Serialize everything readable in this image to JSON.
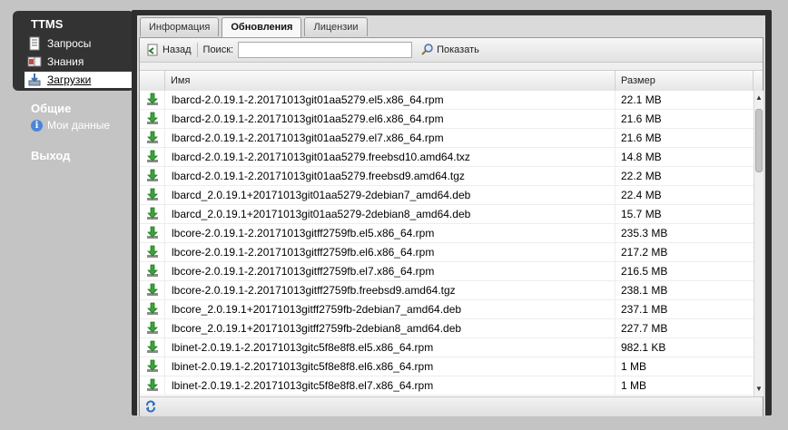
{
  "nav": {
    "title": "TTMS",
    "items": [
      {
        "label": "Запросы",
        "icon": "document-icon"
      },
      {
        "label": "Знания",
        "icon": "book-icon"
      },
      {
        "label": "Загрузки",
        "icon": "download-icon"
      }
    ],
    "section_general": "Общие",
    "my_data": "Мои данные",
    "logout": "Выход"
  },
  "tabs": [
    "Информация",
    "Обновления",
    "Лицензии"
  ],
  "toolbar": {
    "back_label": "Назад",
    "search_label": "Поиск:",
    "search_value": "",
    "show_label": "Показать"
  },
  "grid": {
    "columns": [
      "Имя",
      "Размер"
    ],
    "rows": [
      {
        "name": "lbarcd-2.0.19.1-2.20171013git01aa5279.el5.x86_64.rpm",
        "size": "22.1 MB"
      },
      {
        "name": "lbarcd-2.0.19.1-2.20171013git01aa5279.el6.x86_64.rpm",
        "size": "21.6 MB"
      },
      {
        "name": "lbarcd-2.0.19.1-2.20171013git01aa5279.el7.x86_64.rpm",
        "size": "21.6 MB"
      },
      {
        "name": "lbarcd-2.0.19.1-2.20171013git01aa5279.freebsd10.amd64.txz",
        "size": "14.8 MB"
      },
      {
        "name": "lbarcd-2.0.19.1-2.20171013git01aa5279.freebsd9.amd64.tgz",
        "size": "22.2 MB"
      },
      {
        "name": "lbarcd_2.0.19.1+20171013git01aa5279-2debian7_amd64.deb",
        "size": "22.4 MB"
      },
      {
        "name": "lbarcd_2.0.19.1+20171013git01aa5279-2debian8_amd64.deb",
        "size": "15.7 MB"
      },
      {
        "name": "lbcore-2.0.19.1-2.20171013gitff2759fb.el5.x86_64.rpm",
        "size": "235.3 MB"
      },
      {
        "name": "lbcore-2.0.19.1-2.20171013gitff2759fb.el6.x86_64.rpm",
        "size": "217.2 MB"
      },
      {
        "name": "lbcore-2.0.19.1-2.20171013gitff2759fb.el7.x86_64.rpm",
        "size": "216.5 MB"
      },
      {
        "name": "lbcore-2.0.19.1-2.20171013gitff2759fb.freebsd9.amd64.tgz",
        "size": "238.1 MB"
      },
      {
        "name": "lbcore_2.0.19.1+20171013gitff2759fb-2debian7_amd64.deb",
        "size": "237.1 MB"
      },
      {
        "name": "lbcore_2.0.19.1+20171013gitff2759fb-2debian8_amd64.deb",
        "size": "227.7 MB"
      },
      {
        "name": "lbinet-2.0.19.1-2.20171013gitc5f8e8f8.el5.x86_64.rpm",
        "size": "982.1 KB"
      },
      {
        "name": "lbinet-2.0.19.1-2.20171013gitc5f8e8f8.el6.x86_64.rpm",
        "size": "1 MB"
      },
      {
        "name": "lbinet-2.0.19.1-2.20171013gitc5f8e8f8.el7.x86_64.rpm",
        "size": "1 MB"
      }
    ]
  },
  "colors": {
    "nav_dark": "#333333",
    "download_green": "#3aa33a",
    "accent_blue": "#4a86d8"
  }
}
